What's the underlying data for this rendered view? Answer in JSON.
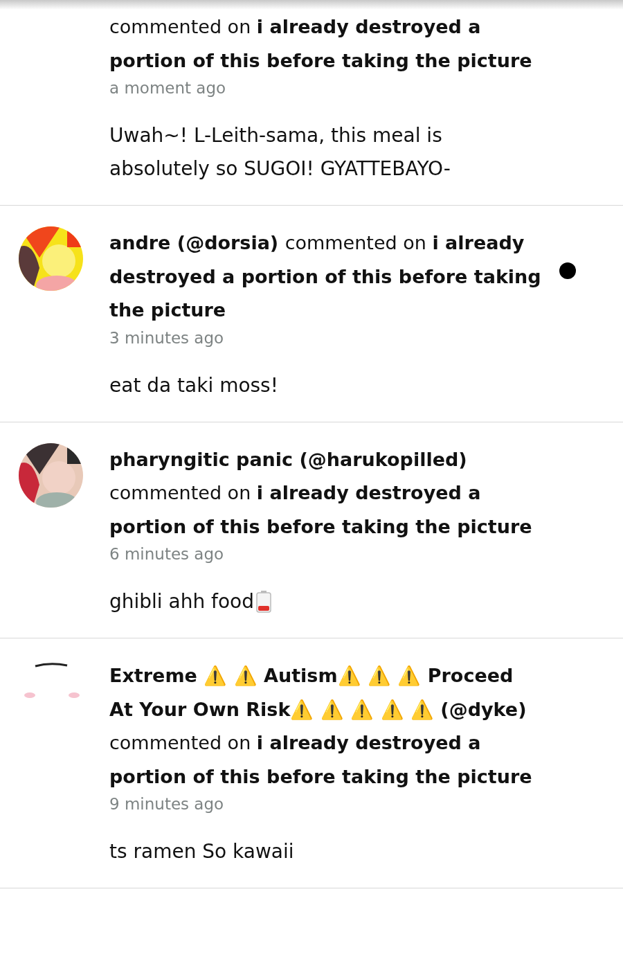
{
  "notifications": [
    {
      "action": "commented on",
      "post_title": "i already destroyed a portion of this before taking the picture",
      "time": "a moment ago",
      "comment": "Uwah~! L-Leith-sama, this meal is absolutely so SUGOI! GYATTEBAYO-",
      "unread": false
    },
    {
      "author": "andre (@dorsia)",
      "action": "commented on",
      "post_title": "i already destroyed a portion of this before taking the picture",
      "time": "3 minutes ago",
      "comment": "eat da taki moss!",
      "unread": true
    },
    {
      "author": "pharyngitic panic (@harukopilled)",
      "action": "commented on",
      "post_title": "i already destroyed a portion of this before taking the picture",
      "time": "6 minutes ago",
      "comment": "ghibli ahh food",
      "comment_icon": {
        "kind": "battery"
      },
      "unread": false
    },
    {
      "avatar": {
        "kind": "drawing"
      },
      "author": "Extreme ⚠️ ⚠️ Autism⚠️  ⚠️ ⚠️ Proceed At Your Own Risk⚠️ ⚠️ ⚠️ ⚠️ ⚠️  (@dyke)",
      "action": "commented on",
      "post_title": "i already destroyed a portion of this before taking the picture",
      "time": "9 minutes ago",
      "comment": "ts ramen So kawaii",
      "unread": false
    }
  ]
}
